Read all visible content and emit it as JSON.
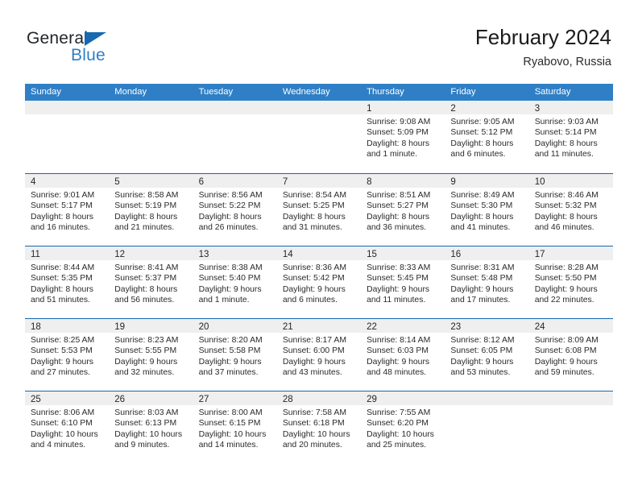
{
  "brand": {
    "name_part1": "General",
    "name_part2": "Blue",
    "flag_icon": "triangle-flag-icon",
    "accent_color": "#2f7fc6",
    "dark_color": "#1769b0"
  },
  "header": {
    "title": "February 2024",
    "subtitle": "Ryabovo, Russia"
  },
  "weekdays": [
    "Sunday",
    "Monday",
    "Tuesday",
    "Wednesday",
    "Thursday",
    "Friday",
    "Saturday"
  ],
  "weeks": [
    [
      {
        "day": "",
        "lines": []
      },
      {
        "day": "",
        "lines": []
      },
      {
        "day": "",
        "lines": []
      },
      {
        "day": "",
        "lines": []
      },
      {
        "day": "1",
        "lines": [
          "Sunrise: 9:08 AM",
          "Sunset: 5:09 PM",
          "Daylight: 8 hours",
          "and 1 minute."
        ]
      },
      {
        "day": "2",
        "lines": [
          "Sunrise: 9:05 AM",
          "Sunset: 5:12 PM",
          "Daylight: 8 hours",
          "and 6 minutes."
        ]
      },
      {
        "day": "3",
        "lines": [
          "Sunrise: 9:03 AM",
          "Sunset: 5:14 PM",
          "Daylight: 8 hours",
          "and 11 minutes."
        ]
      }
    ],
    [
      {
        "day": "4",
        "lines": [
          "Sunrise: 9:01 AM",
          "Sunset: 5:17 PM",
          "Daylight: 8 hours",
          "and 16 minutes."
        ]
      },
      {
        "day": "5",
        "lines": [
          "Sunrise: 8:58 AM",
          "Sunset: 5:19 PM",
          "Daylight: 8 hours",
          "and 21 minutes."
        ]
      },
      {
        "day": "6",
        "lines": [
          "Sunrise: 8:56 AM",
          "Sunset: 5:22 PM",
          "Daylight: 8 hours",
          "and 26 minutes."
        ]
      },
      {
        "day": "7",
        "lines": [
          "Sunrise: 8:54 AM",
          "Sunset: 5:25 PM",
          "Daylight: 8 hours",
          "and 31 minutes."
        ]
      },
      {
        "day": "8",
        "lines": [
          "Sunrise: 8:51 AM",
          "Sunset: 5:27 PM",
          "Daylight: 8 hours",
          "and 36 minutes."
        ]
      },
      {
        "day": "9",
        "lines": [
          "Sunrise: 8:49 AM",
          "Sunset: 5:30 PM",
          "Daylight: 8 hours",
          "and 41 minutes."
        ]
      },
      {
        "day": "10",
        "lines": [
          "Sunrise: 8:46 AM",
          "Sunset: 5:32 PM",
          "Daylight: 8 hours",
          "and 46 minutes."
        ]
      }
    ],
    [
      {
        "day": "11",
        "lines": [
          "Sunrise: 8:44 AM",
          "Sunset: 5:35 PM",
          "Daylight: 8 hours",
          "and 51 minutes."
        ]
      },
      {
        "day": "12",
        "lines": [
          "Sunrise: 8:41 AM",
          "Sunset: 5:37 PM",
          "Daylight: 8 hours",
          "and 56 minutes."
        ]
      },
      {
        "day": "13",
        "lines": [
          "Sunrise: 8:38 AM",
          "Sunset: 5:40 PM",
          "Daylight: 9 hours",
          "and 1 minute."
        ]
      },
      {
        "day": "14",
        "lines": [
          "Sunrise: 8:36 AM",
          "Sunset: 5:42 PM",
          "Daylight: 9 hours",
          "and 6 minutes."
        ]
      },
      {
        "day": "15",
        "lines": [
          "Sunrise: 8:33 AM",
          "Sunset: 5:45 PM",
          "Daylight: 9 hours",
          "and 11 minutes."
        ]
      },
      {
        "day": "16",
        "lines": [
          "Sunrise: 8:31 AM",
          "Sunset: 5:48 PM",
          "Daylight: 9 hours",
          "and 17 minutes."
        ]
      },
      {
        "day": "17",
        "lines": [
          "Sunrise: 8:28 AM",
          "Sunset: 5:50 PM",
          "Daylight: 9 hours",
          "and 22 minutes."
        ]
      }
    ],
    [
      {
        "day": "18",
        "lines": [
          "Sunrise: 8:25 AM",
          "Sunset: 5:53 PM",
          "Daylight: 9 hours",
          "and 27 minutes."
        ]
      },
      {
        "day": "19",
        "lines": [
          "Sunrise: 8:23 AM",
          "Sunset: 5:55 PM",
          "Daylight: 9 hours",
          "and 32 minutes."
        ]
      },
      {
        "day": "20",
        "lines": [
          "Sunrise: 8:20 AM",
          "Sunset: 5:58 PM",
          "Daylight: 9 hours",
          "and 37 minutes."
        ]
      },
      {
        "day": "21",
        "lines": [
          "Sunrise: 8:17 AM",
          "Sunset: 6:00 PM",
          "Daylight: 9 hours",
          "and 43 minutes."
        ]
      },
      {
        "day": "22",
        "lines": [
          "Sunrise: 8:14 AM",
          "Sunset: 6:03 PM",
          "Daylight: 9 hours",
          "and 48 minutes."
        ]
      },
      {
        "day": "23",
        "lines": [
          "Sunrise: 8:12 AM",
          "Sunset: 6:05 PM",
          "Daylight: 9 hours",
          "and 53 minutes."
        ]
      },
      {
        "day": "24",
        "lines": [
          "Sunrise: 8:09 AM",
          "Sunset: 6:08 PM",
          "Daylight: 9 hours",
          "and 59 minutes."
        ]
      }
    ],
    [
      {
        "day": "25",
        "lines": [
          "Sunrise: 8:06 AM",
          "Sunset: 6:10 PM",
          "Daylight: 10 hours",
          "and 4 minutes."
        ]
      },
      {
        "day": "26",
        "lines": [
          "Sunrise: 8:03 AM",
          "Sunset: 6:13 PM",
          "Daylight: 10 hours",
          "and 9 minutes."
        ]
      },
      {
        "day": "27",
        "lines": [
          "Sunrise: 8:00 AM",
          "Sunset: 6:15 PM",
          "Daylight: 10 hours",
          "and 14 minutes."
        ]
      },
      {
        "day": "28",
        "lines": [
          "Sunrise: 7:58 AM",
          "Sunset: 6:18 PM",
          "Daylight: 10 hours",
          "and 20 minutes."
        ]
      },
      {
        "day": "29",
        "lines": [
          "Sunrise: 7:55 AM",
          "Sunset: 6:20 PM",
          "Daylight: 10 hours",
          "and 25 minutes."
        ]
      },
      {
        "day": "",
        "lines": []
      },
      {
        "day": "",
        "lines": []
      }
    ]
  ]
}
